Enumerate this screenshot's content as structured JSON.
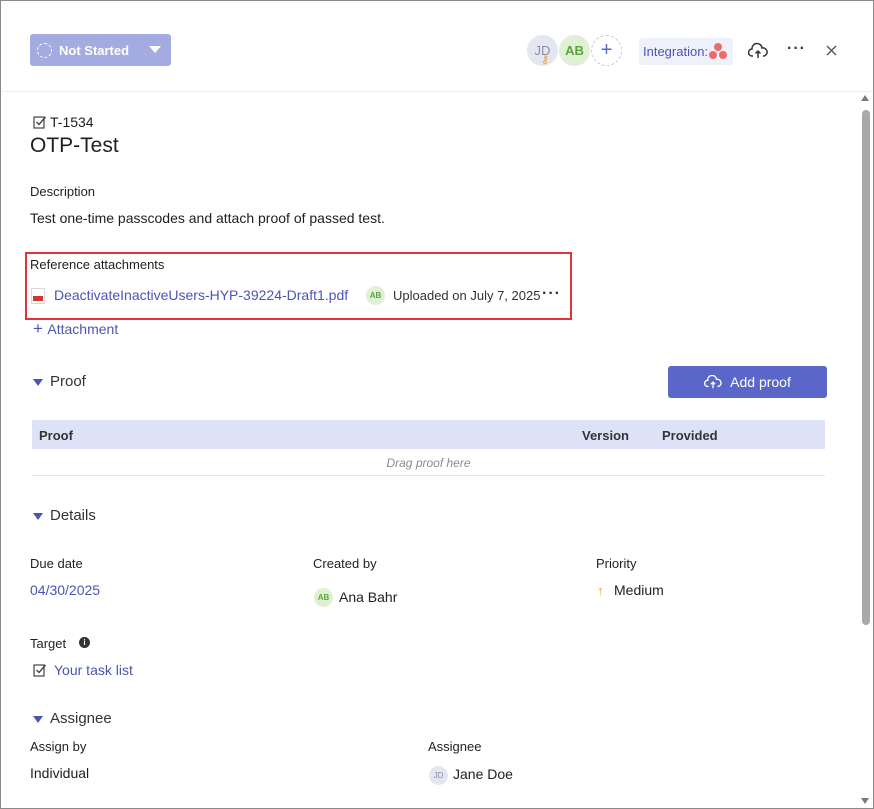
{
  "header": {
    "status_label": "Not Started",
    "avatars": [
      {
        "initials": "JD",
        "color": "#8a8fa8"
      },
      {
        "initials": "AB",
        "color": "#5aa63a"
      }
    ],
    "add_icon": "plus-icon",
    "integration_label": "Integration:",
    "integration_icon": "asana-icon",
    "icons": [
      "cloud-upload-icon",
      "more-icon",
      "close-icon"
    ]
  },
  "task": {
    "id": "T-1534",
    "title": "OTP-Test",
    "description_label": "Description",
    "description": "Test one-time passcodes and attach proof of passed test."
  },
  "attachments": {
    "label": "Reference attachments",
    "file_name": "DeactivateInactiveUsers-HYP-39224-Draft1.pdf",
    "uploader_initials": "AB",
    "uploaded_text": "Uploaded on July 7, 2025",
    "add_label": "Attachment"
  },
  "proof": {
    "section_title": "Proof",
    "add_button": "Add proof",
    "columns": [
      "Proof",
      "Version",
      "Provided"
    ],
    "empty_text": "Drag proof here"
  },
  "details": {
    "section_title": "Details",
    "due_date_label": "Due date",
    "due_date": "04/30/2025",
    "created_by_label": "Created by",
    "created_by_initials": "AB",
    "created_by": "Ana Bahr",
    "priority_label": "Priority",
    "priority": "Medium",
    "target_label": "Target",
    "target_value": "Your task list"
  },
  "assignee": {
    "section_title": "Assignee",
    "assign_by_label": "Assign by",
    "assign_by": "Individual",
    "assignee_label": "Assignee",
    "assignee_initials": "JD",
    "assignee_name": "Jane Doe"
  },
  "colors": {
    "accent": "#5b67c8",
    "status_button": "#a3abe0",
    "highlight": "#e2333a",
    "priority_arrow": "#e8a323"
  }
}
